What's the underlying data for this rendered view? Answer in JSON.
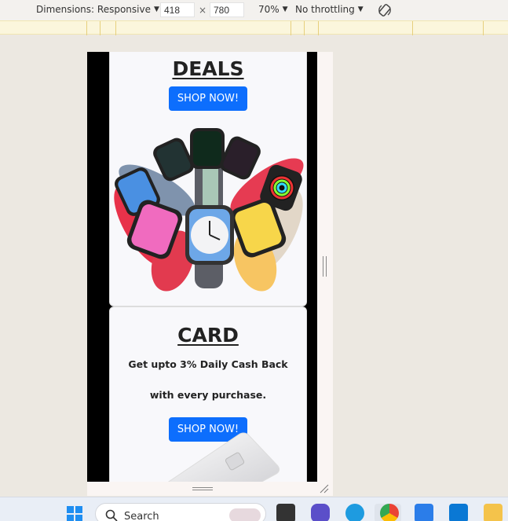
{
  "devtools": {
    "dimensions_label": "Dimensions: Responsive",
    "width_value": "418",
    "times": "×",
    "height_value": "780",
    "zoom": "70%",
    "throttling": "No throttling"
  },
  "page": {
    "deals": {
      "heading": "DEALS",
      "button": "SHOP NOW!"
    },
    "card": {
      "heading": "CARD",
      "line1": "Get upto 3% Daily Cash Back",
      "line2": "with every purchase.",
      "button": "SHOP NOW!"
    }
  },
  "taskbar": {
    "search_label": "Search"
  },
  "colors": {
    "button_blue": "#0d6efd",
    "toolbar_bg": "#f3f1ee",
    "media_bar": "#fbf6dc"
  }
}
